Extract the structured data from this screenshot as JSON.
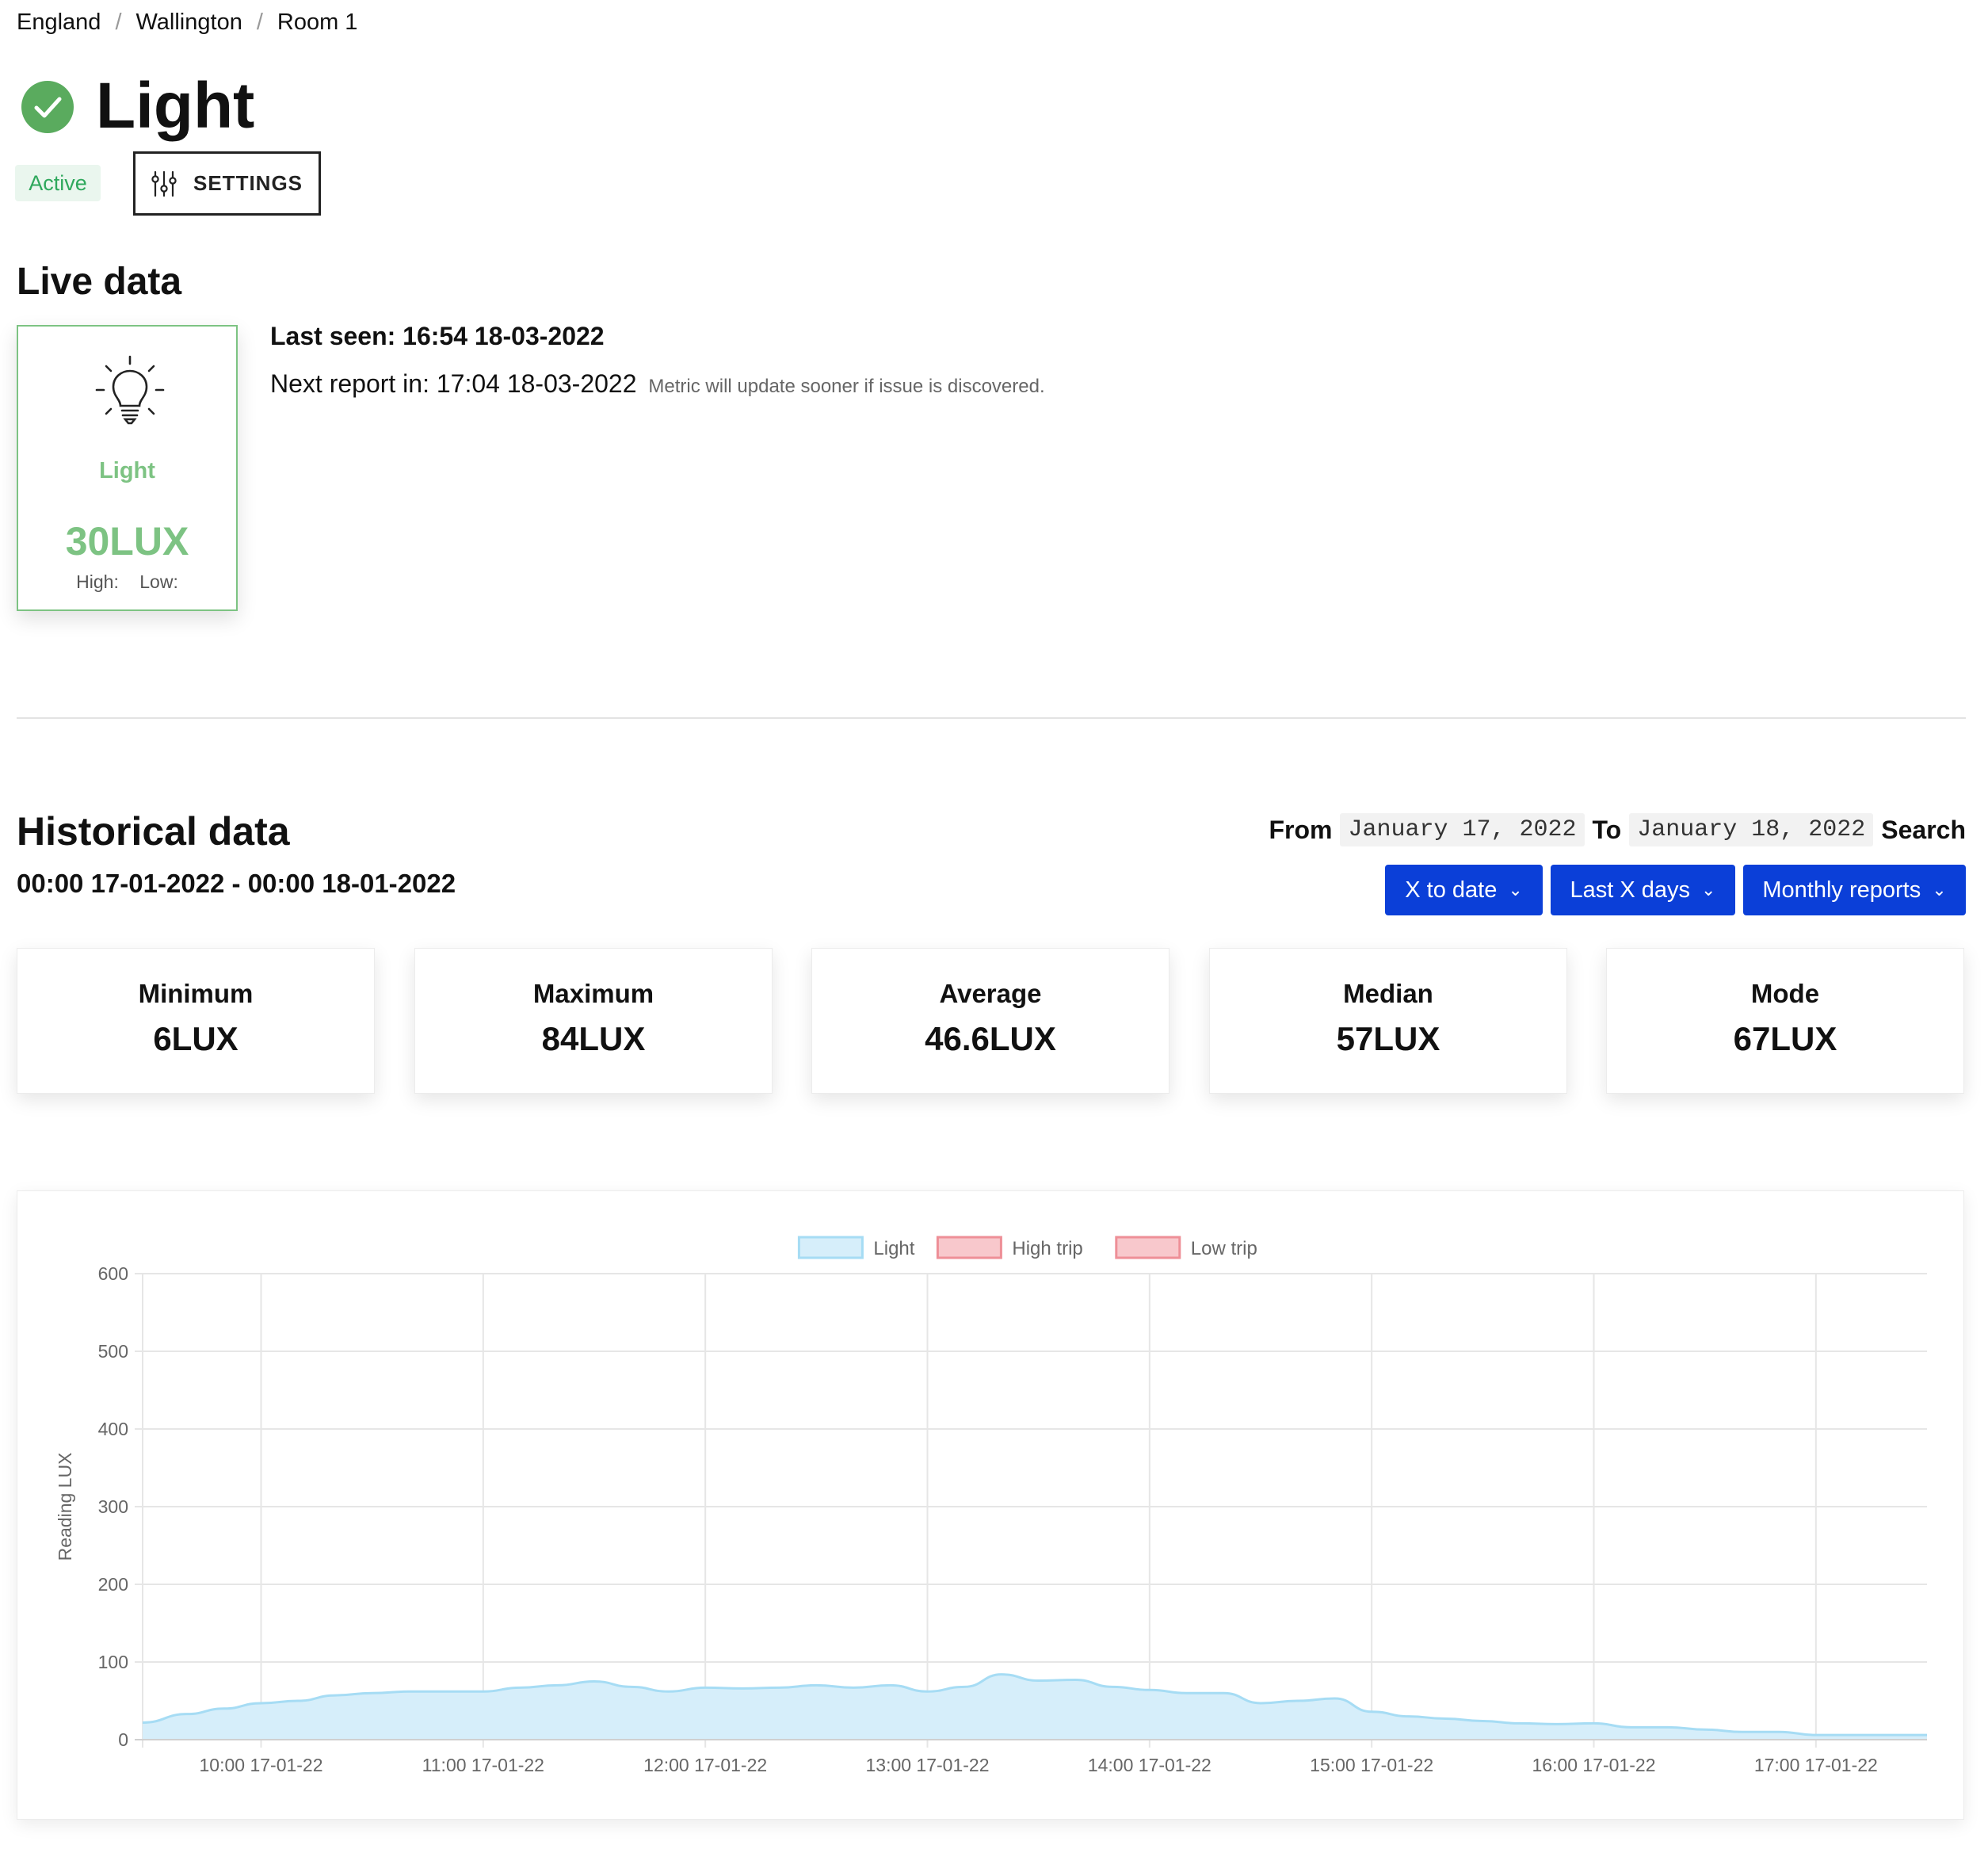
{
  "breadcrumb": [
    "England",
    "Wallington",
    "Room 1"
  ],
  "header": {
    "title": "Light",
    "status": "Active",
    "settings_label": "SETTINGS"
  },
  "live": {
    "title": "Live data",
    "sensor": {
      "name": "Light",
      "value": "30LUX",
      "high_label": "High:",
      "low_label": "Low:"
    },
    "last_seen": "Last seen: 16:54 18-03-2022",
    "next_report": "Next report in: 17:04 18-03-2022",
    "next_report_note": "Metric will update sooner if issue is discovered."
  },
  "historical": {
    "title": "Historical data",
    "range": "00:00 17-01-2022 - 00:00 18-01-2022",
    "from_label": "From",
    "from_date": "January 17, 2022",
    "to_label": "To",
    "to_date": "January 18, 2022",
    "search_label": "Search",
    "buttons": [
      "X to date",
      "Last X days",
      "Monthly reports"
    ],
    "stats": [
      {
        "label": "Minimum",
        "value": "6LUX"
      },
      {
        "label": "Maximum",
        "value": "84LUX"
      },
      {
        "label": "Average",
        "value": "46.6LUX"
      },
      {
        "label": "Median",
        "value": "57LUX"
      },
      {
        "label": "Mode",
        "value": "67LUX"
      }
    ]
  },
  "colors": {
    "brand_blue": "#0b3fd8",
    "ok_green": "#5aab5e",
    "light_fill": "#d6eefa",
    "light_line": "#a6dcf4",
    "trip_fill": "#f8c8cc",
    "trip_line": "#ee8f97"
  },
  "chart_data": {
    "type": "area",
    "ylabel": "Reading LUX",
    "ylim": [
      0,
      600
    ],
    "yticks": [
      0,
      100,
      200,
      300,
      400,
      500,
      600
    ],
    "x_tick_labels": [
      "10:00 17-01-22",
      "11:00 17-01-22",
      "12:00 17-01-22",
      "13:00 17-01-22",
      "14:00 17-01-22",
      "15:00 17-01-22",
      "16:00 17-01-22",
      "17:00 17-01-22"
    ],
    "legend": [
      "Light",
      "High trip",
      "Low trip"
    ],
    "legend_position": "top",
    "grid": true,
    "x": [
      "09:28",
      "09:40",
      "09:50",
      "10:00",
      "10:10",
      "10:20",
      "10:30",
      "10:40",
      "10:50",
      "11:00",
      "11:10",
      "11:20",
      "11:30",
      "11:40",
      "11:50",
      "12:00",
      "12:10",
      "12:20",
      "12:30",
      "12:40",
      "12:50",
      "13:00",
      "13:10",
      "13:20",
      "13:30",
      "13:40",
      "13:50",
      "14:00",
      "14:10",
      "14:20",
      "14:30",
      "14:40",
      "14:50",
      "15:00",
      "15:10",
      "15:20",
      "15:30",
      "15:40",
      "15:50",
      "16:00",
      "16:10",
      "16:20",
      "16:30",
      "16:40",
      "16:50",
      "17:00",
      "17:10",
      "17:20",
      "17:30"
    ],
    "series": [
      {
        "name": "Light",
        "values": [
          22,
          33,
          40,
          47,
          50,
          57,
          60,
          62,
          62,
          62,
          67,
          70,
          75,
          68,
          62,
          67,
          66,
          67,
          70,
          67,
          70,
          62,
          68,
          84,
          76,
          77,
          68,
          64,
          60,
          60,
          47,
          50,
          53,
          36,
          30,
          27,
          24,
          21,
          20,
          21,
          16,
          16,
          13,
          10,
          10,
          6,
          6,
          6,
          6
        ]
      }
    ]
  }
}
